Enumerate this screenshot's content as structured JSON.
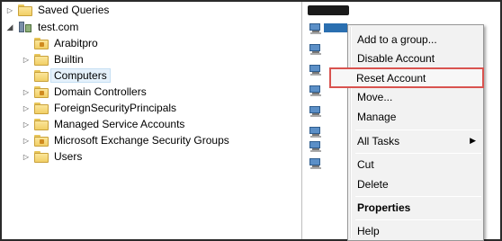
{
  "tree": {
    "saved_queries": "Saved Queries",
    "domain": "test.com",
    "items": [
      {
        "label": "Arabitpro",
        "expandable": false,
        "icon": "ou-folder-icon"
      },
      {
        "label": "Builtin",
        "expandable": true,
        "icon": "folder-icon"
      },
      {
        "label": "Computers",
        "expandable": false,
        "icon": "folder-icon",
        "selected": true
      },
      {
        "label": "Domain Controllers",
        "expandable": true,
        "icon": "ou-folder-icon"
      },
      {
        "label": "ForeignSecurityPrincipals",
        "expandable": true,
        "icon": "folder-icon"
      },
      {
        "label": "Managed Service Accounts",
        "expandable": true,
        "icon": "folder-icon"
      },
      {
        "label": "Microsoft Exchange Security Groups",
        "expandable": true,
        "icon": "ou-folder-icon"
      },
      {
        "label": "Users",
        "expandable": true,
        "icon": "folder-icon"
      }
    ]
  },
  "context_menu": {
    "items": [
      {
        "label": "Add to a group..."
      },
      {
        "label": "Disable Account"
      },
      {
        "label": "Reset Account",
        "highlighted": true
      },
      {
        "label": "Move..."
      },
      {
        "label": "Manage"
      },
      {
        "label": "All Tasks",
        "submenu": true
      },
      {
        "label": "Cut"
      },
      {
        "label": "Delete"
      },
      {
        "label": "Properties",
        "bold": true
      },
      {
        "label": "Help"
      }
    ],
    "highlight_color": "#d9534f"
  },
  "computer_list": {
    "icon": "computer-icon",
    "count": 8
  }
}
